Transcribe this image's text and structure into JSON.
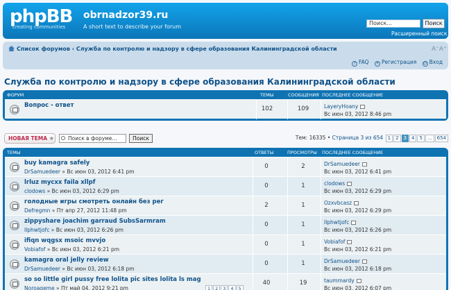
{
  "header": {
    "logo_text": "phpBB",
    "logo_sub": "creating   communities",
    "site_title": "obrnadzor39.ru",
    "site_desc": "A short text to describe your forum",
    "search_placeholder": "Поиск...",
    "search_button": "Поиск",
    "advanced_search": "Расширенный поиск"
  },
  "navbar": {
    "crumb_home": "Список форумов",
    "crumb_sep": "‹",
    "crumb_forum": "Служба по контролю и надзору в сфере образования Калининградской области",
    "fontsize": "A⁻A⁺",
    "faq": "FAQ",
    "register": "Регистрация",
    "login": "Вход"
  },
  "page_title": "Служба по контролю и надзору в сфере образования Калининградской области",
  "forums_table": {
    "headers": {
      "forum": "ФОРУМ",
      "topics": "ТЕМЫ",
      "posts": "СООБЩЕНИЯ",
      "last": "ПОСЛЕДНЕЕ СООБЩЕНИЕ"
    },
    "rows": [
      {
        "title": "Вопрос - ответ",
        "topics": "102",
        "posts": "109",
        "last_user": "LayeryHoany",
        "last_date": "Вс июн 03, 2012 8:46 pm"
      }
    ]
  },
  "toolbar": {
    "new_topic": "НОВАЯ ТЕМА",
    "new_topic_star": "★",
    "forum_search_placeholder": "Поиск в форуме...",
    "forum_search_button": "Поиск",
    "topics_count": "Тем: 16335",
    "page_info": "Страница 3 из 654",
    "pages": [
      "1",
      "2",
      "3",
      "4",
      "5",
      "...",
      "654"
    ],
    "current_page": "3"
  },
  "topics_table": {
    "headers": {
      "topics": "ТЕМЫ",
      "replies": "ОТВЕТЫ",
      "views": "ПРОСМОТРЫ",
      "last": "ПОСЛЕДНЕЕ СООБЩЕНИЕ"
    },
    "rows": [
      {
        "title": "buy kamagra safely",
        "author": "DrSamuedeer",
        "date": "» Вс июн 03, 2012 6:41 pm",
        "replies": "0",
        "views": "2",
        "last_user": "DrSamuedeer",
        "last_date": "Вс июн 03, 2012 6:41 pm"
      },
      {
        "title": "lrluz mycxx faila xllpf",
        "author": "clodows",
        "date": "» Вс июн 03, 2012 6:29 pm",
        "replies": "0",
        "views": "1",
        "last_user": "clodows",
        "last_date": "Вс июн 03, 2012 6:29 pm"
      },
      {
        "title": "голодные игры смотреть онлайн без рег",
        "author": "Defregmn",
        "date": "» Пт апр 27, 2012 11:48 pm",
        "replies": "2",
        "views": "1",
        "last_user": "Ozxvbcasz",
        "last_date": "Вс июн 03, 2012 6:29 pm"
      },
      {
        "title": "zippyshare joachim garraud SubsSarmram",
        "author": "Ilphwtjofc",
        "date": "» Вс июн 03, 2012 6:26 pm",
        "replies": "0",
        "views": "1",
        "last_user": "Ilphwtjofc",
        "last_date": "Вс июн 03, 2012 6:26 pm"
      },
      {
        "title": "ifiqn wqgsx msoic mvvjo",
        "author": "Vobiafof",
        "date": "» Вс июн 03, 2012 6:21 pm",
        "replies": "0",
        "views": "1",
        "last_user": "Vobiafof",
        "last_date": "Вс июн 03, 2012 6:21 pm"
      },
      {
        "title": "kamagra oral jelly review",
        "author": "DrSamuedeer",
        "date": "» Вс июн 03, 2012 6:18 pm",
        "replies": "0",
        "views": "1",
        "last_user": "DrSamuedeer",
        "last_date": "Вс июн 03, 2012 6:18 pm"
      },
      {
        "title": "so so little girl pussy free lolita pic sites lolita ls mag",
        "author": "Noroageme",
        "date": "» Пт май 04, 2012 9:21 pm",
        "replies": "40",
        "views": "19",
        "last_user": "taummardy",
        "last_date": "Вс июн 03, 2012 6:07 pm",
        "pages": [
          "1",
          "2",
          "3",
          "4",
          "5"
        ]
      }
    ]
  }
}
